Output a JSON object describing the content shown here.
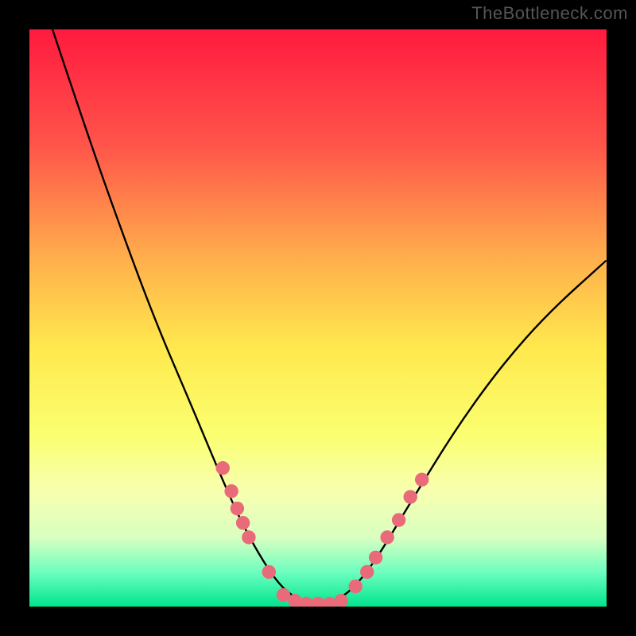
{
  "watermark": "TheBottleneck.com",
  "chart_data": {
    "type": "line",
    "title": "",
    "xlabel": "",
    "ylabel": "",
    "xlim": [
      0,
      100
    ],
    "ylim": [
      0,
      100
    ],
    "background_gradient": {
      "stops": [
        {
          "offset": 0,
          "color": "#ff1a3f"
        },
        {
          "offset": 20,
          "color": "#ff554a"
        },
        {
          "offset": 40,
          "color": "#ffb04c"
        },
        {
          "offset": 55,
          "color": "#ffe84d"
        },
        {
          "offset": 70,
          "color": "#fbff6f"
        },
        {
          "offset": 80,
          "color": "#f7ffb0"
        },
        {
          "offset": 88,
          "color": "#d9ffc0"
        },
        {
          "offset": 94,
          "color": "#6dffc0"
        },
        {
          "offset": 100,
          "color": "#00e48e"
        }
      ]
    },
    "series": [
      {
        "name": "bottleneck-curve",
        "color": "#000000",
        "points": [
          {
            "x": 4,
            "y": 100
          },
          {
            "x": 10,
            "y": 82
          },
          {
            "x": 16,
            "y": 65
          },
          {
            "x": 22,
            "y": 49
          },
          {
            "x": 28,
            "y": 35
          },
          {
            "x": 33,
            "y": 23
          },
          {
            "x": 37,
            "y": 14
          },
          {
            "x": 41,
            "y": 7
          },
          {
            "x": 44,
            "y": 3
          },
          {
            "x": 47,
            "y": 1
          },
          {
            "x": 50,
            "y": 0
          },
          {
            "x": 53,
            "y": 1
          },
          {
            "x": 56,
            "y": 3
          },
          {
            "x": 60,
            "y": 8
          },
          {
            "x": 66,
            "y": 18
          },
          {
            "x": 74,
            "y": 31
          },
          {
            "x": 82,
            "y": 42
          },
          {
            "x": 90,
            "y": 51
          },
          {
            "x": 100,
            "y": 60
          }
        ]
      }
    ],
    "markers": {
      "color": "#e96b7a",
      "radius_pct": 1.2,
      "points": [
        {
          "x": 33.5,
          "y": 24
        },
        {
          "x": 35,
          "y": 20
        },
        {
          "x": 36,
          "y": 17
        },
        {
          "x": 37,
          "y": 14.5
        },
        {
          "x": 38,
          "y": 12
        },
        {
          "x": 41.5,
          "y": 6
        },
        {
          "x": 44,
          "y": 2
        },
        {
          "x": 46,
          "y": 1
        },
        {
          "x": 48,
          "y": 0.5
        },
        {
          "x": 50,
          "y": 0.5
        },
        {
          "x": 52,
          "y": 0.5
        },
        {
          "x": 54,
          "y": 1
        },
        {
          "x": 56.5,
          "y": 3.5
        },
        {
          "x": 58.5,
          "y": 6
        },
        {
          "x": 60,
          "y": 8.5
        },
        {
          "x": 62,
          "y": 12
        },
        {
          "x": 64,
          "y": 15
        },
        {
          "x": 66,
          "y": 19
        },
        {
          "x": 68,
          "y": 22
        }
      ]
    }
  }
}
